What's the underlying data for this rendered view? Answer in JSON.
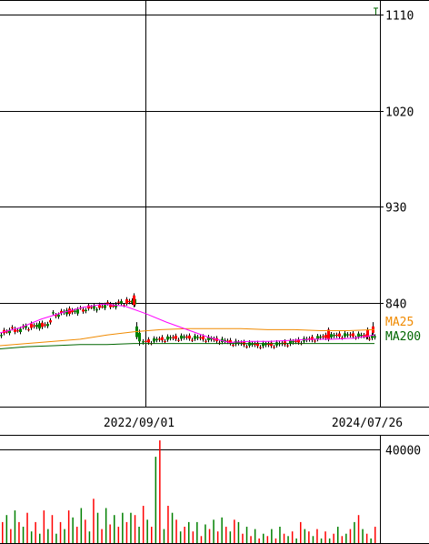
{
  "chart_data": [
    {
      "type": "candlestick",
      "title": "",
      "y_ticks": [
        1110,
        1020,
        930,
        840
      ],
      "ylim": [
        750,
        1125
      ],
      "x_ticks": [
        "2022/09/01",
        "2024/07/26"
      ],
      "gridlines": true,
      "legend": {
        "placement": "right",
        "entries": [
          "MA25",
          "MA200"
        ]
      },
      "series": [
        {
          "name": "MA25",
          "color": "#f08a00",
          "values": [
            800,
            802,
            804,
            806,
            810,
            813,
            815,
            816,
            816,
            816,
            815,
            815,
            814,
            814,
            815
          ]
        },
        {
          "name": "MA200",
          "color": "#006600",
          "values": [
            797,
            799,
            800,
            801,
            801,
            802,
            802,
            802,
            802,
            802,
            802,
            802,
            802,
            802,
            802
          ]
        },
        {
          "name": "",
          "color": "#ff00ff",
          "values": [
            812,
            817,
            825,
            831,
            836,
            839,
            837,
            830,
            822,
            815,
            808,
            803,
            804,
            804,
            805,
            806,
            806,
            807,
            810
          ]
        }
      ],
      "price_range": {
        "low_before_gap": 812,
        "high_before_gap": 846,
        "low_after_gap": 796,
        "high_after_gap": 818,
        "outlier_high": 1116
      }
    },
    {
      "type": "bar",
      "title": "",
      "series_name": "volume",
      "y_ticks": [
        40000
      ],
      "ylim": [
        0,
        46000
      ],
      "values": [
        9000,
        12000,
        6000,
        14000,
        9000,
        7000,
        13000,
        5000,
        9000,
        4000,
        14000,
        6000,
        12000,
        4000,
        9000,
        6000,
        14000,
        11000,
        7000,
        15000,
        10000,
        5000,
        19000,
        13000,
        6000,
        15000,
        8000,
        12000,
        7000,
        13000,
        9000,
        13000,
        12000,
        7000,
        16000,
        10000,
        7000,
        37000,
        44000,
        6000,
        16000,
        13000,
        10000,
        5000,
        7000,
        9000,
        5000,
        9000,
        3000,
        8000,
        6000,
        10000,
        5000,
        11000,
        7000,
        5000,
        10000,
        9000,
        4000,
        7000,
        3000,
        6000,
        2000,
        4000,
        3000,
        6000,
        2000,
        7000,
        4000,
        3000,
        5000,
        2000,
        9000,
        6000,
        5000,
        3000,
        6000,
        2000,
        5000,
        2000,
        4000,
        7000,
        3000,
        4000,
        6000,
        9000,
        12000,
        6000,
        4000,
        2000,
        7000
      ]
    }
  ]
}
